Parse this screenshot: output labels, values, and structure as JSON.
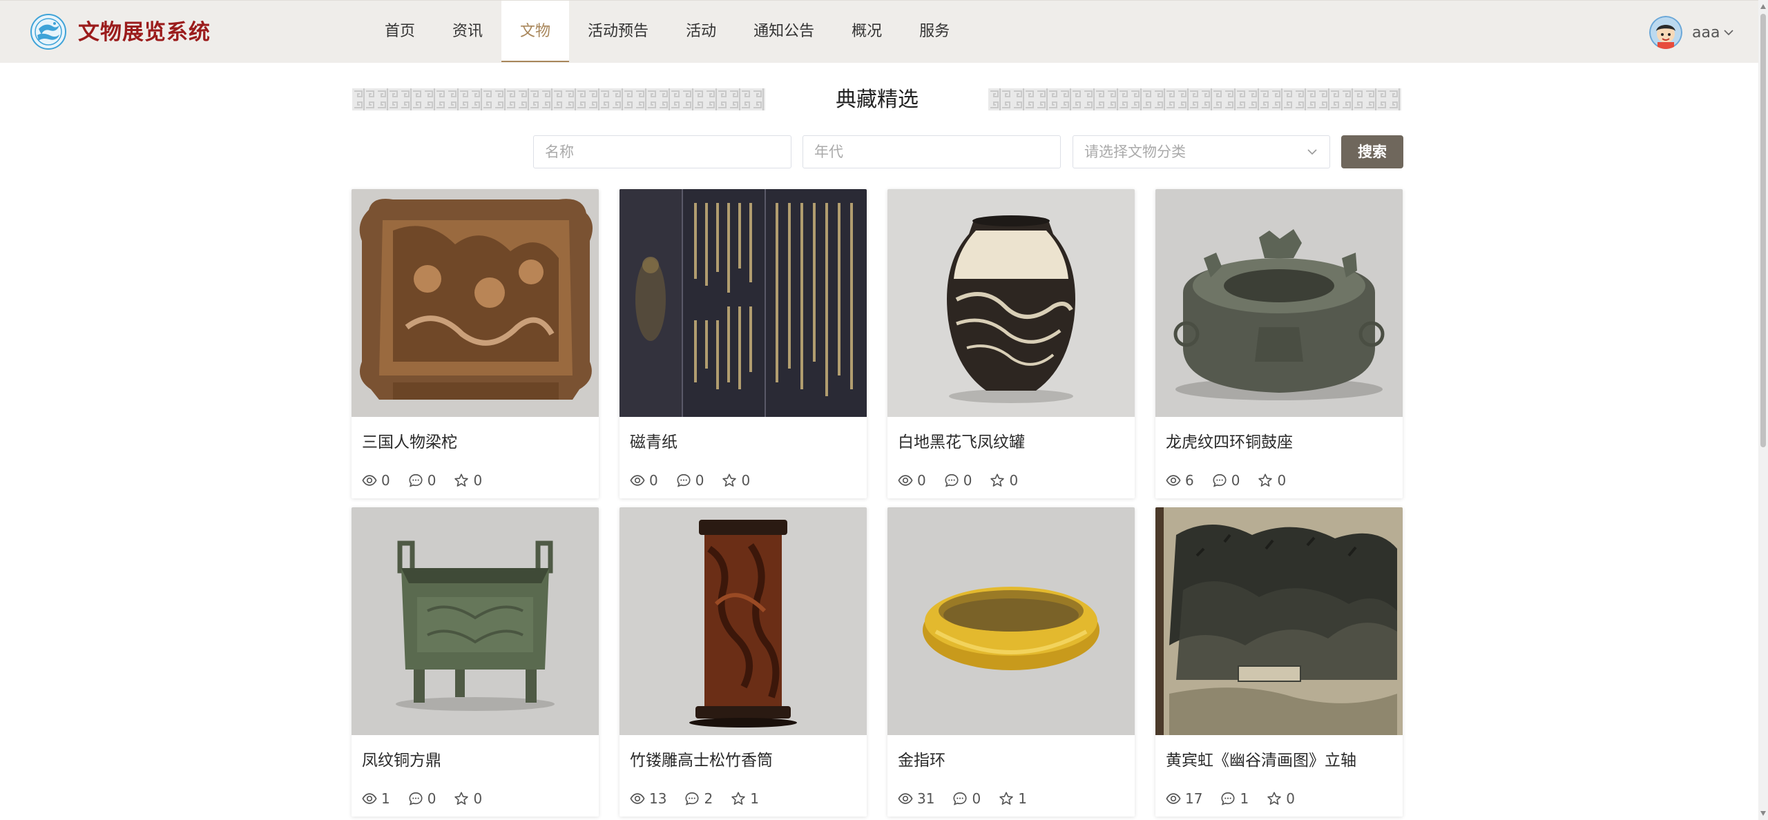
{
  "app": {
    "title": "文物展览系统",
    "accent_color": "#a8865a",
    "brand_color": "#9b1c1c"
  },
  "nav": {
    "items": [
      {
        "label": "首页"
      },
      {
        "label": "资讯"
      },
      {
        "label": "文物",
        "active": true
      },
      {
        "label": "活动预告"
      },
      {
        "label": "活动"
      },
      {
        "label": "通知公告"
      },
      {
        "label": "概况"
      },
      {
        "label": "服务"
      }
    ]
  },
  "user": {
    "name": "aaa",
    "avatar_icon": "avatar-icon",
    "dropdown_icon": "chevron-down-icon"
  },
  "section": {
    "title": "典藏精选"
  },
  "search": {
    "name_placeholder": "名称",
    "era_placeholder": "年代",
    "category_placeholder": "请选择文物分类",
    "button_label": "搜索"
  },
  "artifacts": [
    {
      "name": "三国人物梁柁",
      "views": "0",
      "comments": "0",
      "favorites": "0",
      "image_icon": "wood-carving-image"
    },
    {
      "name": "磁青纸",
      "views": "0",
      "comments": "0",
      "favorites": "0",
      "image_icon": "scripture-image"
    },
    {
      "name": "白地黑花飞凤纹罐",
      "views": "0",
      "comments": "0",
      "favorites": "0",
      "image_icon": "ceramic-jar-image"
    },
    {
      "name": "龙虎纹四环铜鼓座",
      "views": "6",
      "comments": "0",
      "favorites": "0",
      "image_icon": "bronze-drum-base-image"
    },
    {
      "name": "凤纹铜方鼎",
      "views": "1",
      "comments": "0",
      "favorites": "0",
      "image_icon": "bronze-ding-image"
    },
    {
      "name": "竹镂雕高士松竹香筒",
      "views": "13",
      "comments": "2",
      "favorites": "1",
      "image_icon": "bamboo-incense-tube-image"
    },
    {
      "name": "金指环",
      "views": "31",
      "comments": "0",
      "favorites": "1",
      "image_icon": "gold-ring-image"
    },
    {
      "name": "黄宾虹《幽谷清画图》立轴",
      "views": "17",
      "comments": "1",
      "favorites": "0",
      "image_icon": "landscape-painting-image"
    }
  ]
}
